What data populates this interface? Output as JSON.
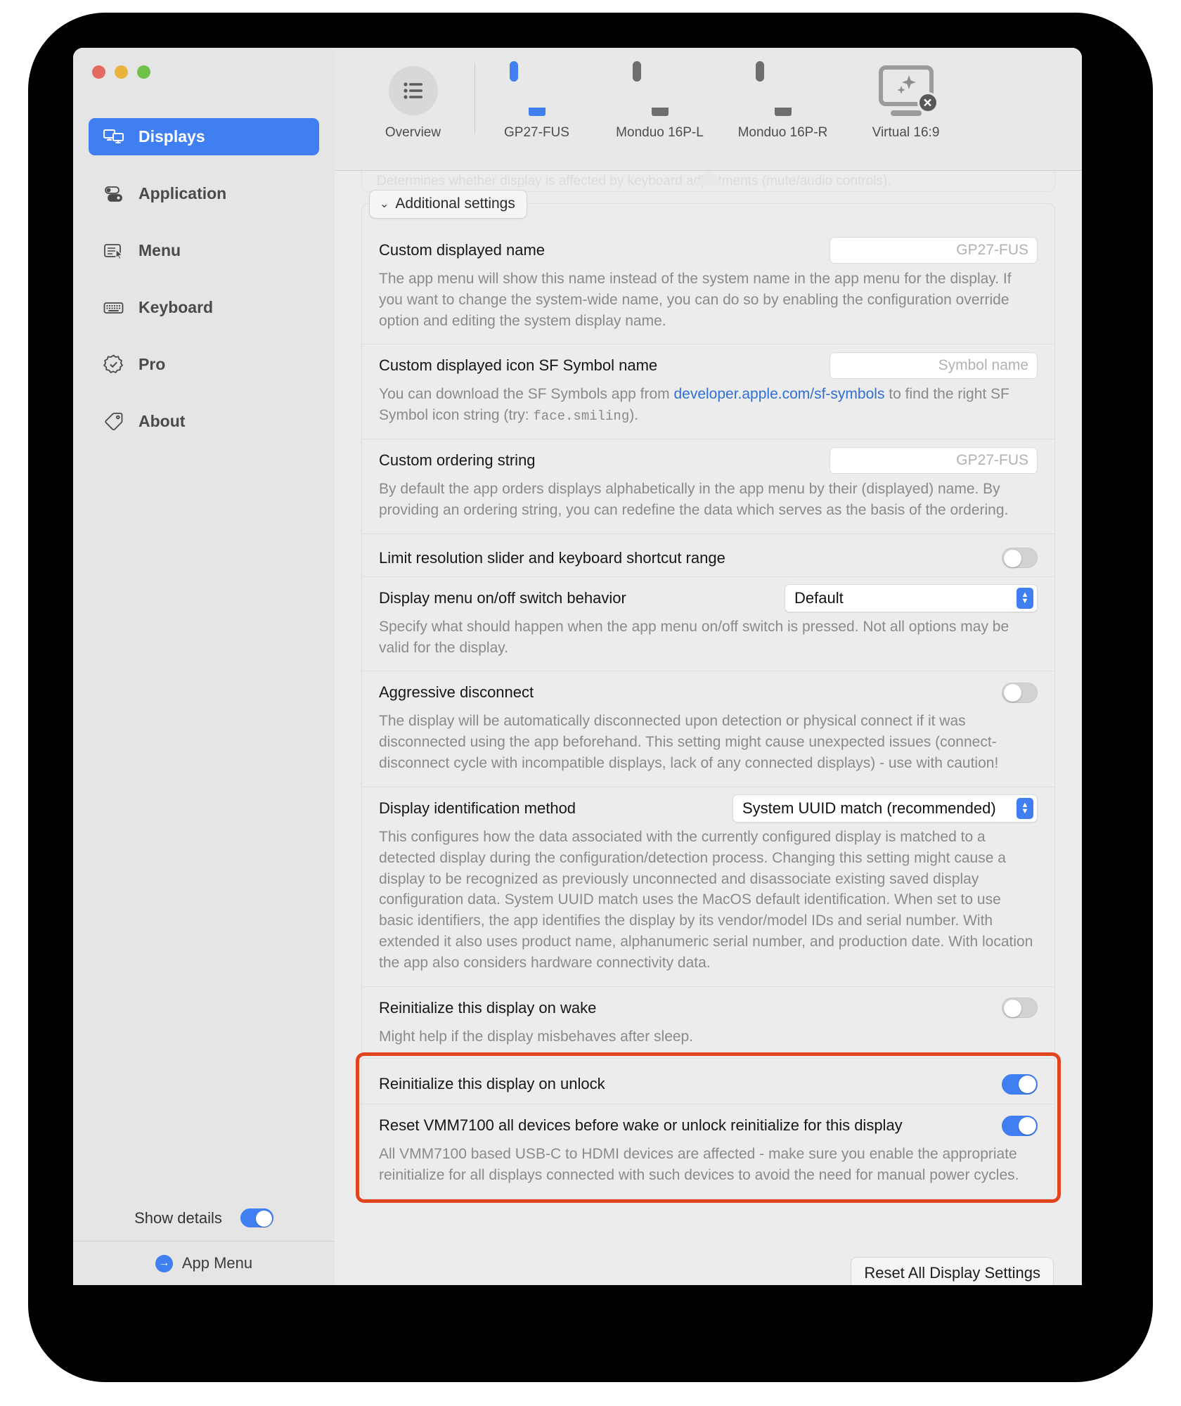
{
  "window": {
    "traffic_lights": [
      "close",
      "minimize",
      "zoom"
    ]
  },
  "sidebar": {
    "items": [
      {
        "label": "Displays",
        "icon": "displays-icon",
        "active": true
      },
      {
        "label": "Application",
        "icon": "toggles-icon",
        "active": false
      },
      {
        "label": "Menu",
        "icon": "menu-cursor-icon",
        "active": false
      },
      {
        "label": "Keyboard",
        "icon": "keyboard-icon",
        "active": false
      },
      {
        "label": "Pro",
        "icon": "seal-check-icon",
        "active": false
      },
      {
        "label": "About",
        "icon": "tag-icon",
        "active": false
      }
    ],
    "show_details_label": "Show details",
    "show_details_on": true,
    "app_menu_label": "App Menu"
  },
  "toolbar": {
    "items": [
      {
        "label": "Overview",
        "icon": "list-bullet-icon",
        "selected": false,
        "kind": "overview"
      },
      {
        "label": "GP27-FUS",
        "icon": "monitor-icon",
        "selected": true,
        "kind": "monitor"
      },
      {
        "label": "Monduo 16P-L",
        "icon": "monitor-icon",
        "selected": false,
        "kind": "monitor"
      },
      {
        "label": "Monduo 16P-R",
        "icon": "monitor-icon",
        "selected": false,
        "kind": "monitor"
      },
      {
        "label": "Virtual 16:9",
        "icon": "monitor-sparkles-icon",
        "selected": false,
        "kind": "virtual",
        "badge": "×"
      }
    ]
  },
  "content": {
    "ghost_text": "Determines whether display is affected by keyboard adjustments (mute/audio controls).",
    "panel_title": "Additional settings",
    "panel_chevron": "⌄",
    "reset_all_button": "Reset All Display Settings",
    "rows": [
      {
        "label": "Custom displayed name",
        "control": "textfield",
        "placeholder": "GP27-FUS",
        "desc": "The app menu will show this name instead of the system name in the app menu for the display. If you want to change the system-wide name, you can do so by enabling the configuration override option and editing the system display name."
      },
      {
        "label": "Custom displayed icon SF Symbol name",
        "control": "textfield",
        "placeholder": "Symbol name",
        "desc_part1": "You can download the SF Symbols app from ",
        "desc_link": "developer.apple.com/sf-symbols",
        "desc_part2": " to find the right SF Symbol icon string (try: ",
        "desc_mono": "face.smiling",
        "desc_part3": ")."
      },
      {
        "label": "Custom ordering string",
        "control": "textfield",
        "placeholder": "GP27-FUS",
        "desc": "By default the app orders displays alphabetically in the app menu by their (displayed) name. By providing an ordering string, you can redefine the data which serves as the basis of the ordering."
      },
      {
        "label": "Limit resolution slider and keyboard shortcut range",
        "control": "switch",
        "value": false,
        "desc": ""
      },
      {
        "label": "Display menu on/off switch behavior",
        "control": "select",
        "value": "Default",
        "desc": "Specify what should happen when the app menu on/off switch is pressed. Not all options may be valid for the display."
      },
      {
        "label": "Aggressive disconnect",
        "control": "switch",
        "value": false,
        "desc": "The display will be automatically disconnected upon detection or physical connect if it was disconnected using the app beforehand. This setting might cause unexpected issues (connect-disconnect cycle with incompatible displays, lack of any connected displays) - use with caution!"
      },
      {
        "label": "Display identification method",
        "control": "select",
        "value": "System UUID match (recommended)",
        "desc": "This configures how the data associated with the currently configured display is matched to a detected display during the configuration/detection process. Changing this setting might cause a display to be recognized as previously unconnected and disassociate existing saved display configuration data. System UUID match uses the MacOS default identification. When set to use basic identifiers, the app identifies the display by its vendor/model IDs and serial number. With extended it also uses product name, alphanumeric serial number, and production date. With location the app also considers hardware connectivity data."
      },
      {
        "label": "Reinitialize this display on wake",
        "control": "switch",
        "value": false,
        "desc": "Might help if the display misbehaves after sleep."
      },
      {
        "label": "Reinitialize this display on unlock",
        "control": "switch",
        "value": true,
        "desc": ""
      },
      {
        "label": "Reset VMM7100 all devices before wake or unlock reinitialize for this display",
        "control": "switch",
        "value": true,
        "desc": "All VMM7100 based USB-C to HDMI devices are affected - make sure you enable the appropriate reinitialize for all displays connected with such devices to avoid the need for manual power cycles."
      }
    ]
  },
  "colors": {
    "accent": "#3f7ff2",
    "highlight": "#e0441b",
    "window_bg": "#ececec",
    "sidebar_bg": "#e6e5e5",
    "link": "#2f6fd8"
  }
}
